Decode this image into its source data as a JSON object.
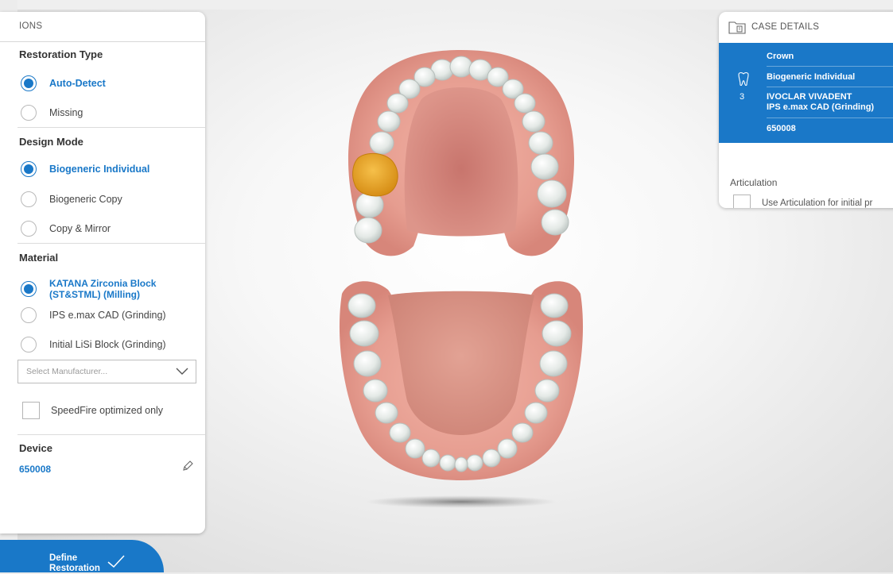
{
  "options_panel": {
    "header": "IONS",
    "restoration_type": {
      "title": "Restoration Type",
      "options": [
        "Auto-Detect",
        "Missing"
      ],
      "selected": "Auto-Detect"
    },
    "design_mode": {
      "title": "Design Mode",
      "options": [
        "Biogeneric Individual",
        "Biogeneric Copy",
        "Copy & Mirror"
      ],
      "selected": "Biogeneric Individual"
    },
    "material": {
      "title": "Material",
      "options": [
        "KATANA Zirconia Block (ST&STML) (Milling)",
        "IPS e.max CAD (Grinding)",
        "Initial LiSi Block (Grinding)"
      ],
      "selected": "KATANA Zirconia Block (ST&STML) (Milling)",
      "manufacturer_placeholder": "Select Manufacturer...",
      "speedfire_label": "SpeedFire optimized only"
    },
    "device": {
      "title": "Device",
      "value": "650008"
    }
  },
  "workflow_tab": {
    "label_line1": "Define",
    "label_line2": "Restoration",
    "status": "completed"
  },
  "case_details": {
    "title": "CASE DETAILS",
    "restoration": {
      "tooth_number": "3",
      "type": "Crown",
      "design_mode": "Biogeneric Individual",
      "manufacturer": "IVOCLAR VIVADENT",
      "material": "IPS e.max CAD (Grinding)",
      "device": "650008"
    },
    "articulation_title": "Articulation",
    "articulation_checkbox_label": "Use Articulation for initial pr"
  },
  "colors": {
    "accent": "#1978c8",
    "selected_tooth": "#e8a420",
    "gum": "#e69d90",
    "tooth": "#e4e9e6"
  }
}
